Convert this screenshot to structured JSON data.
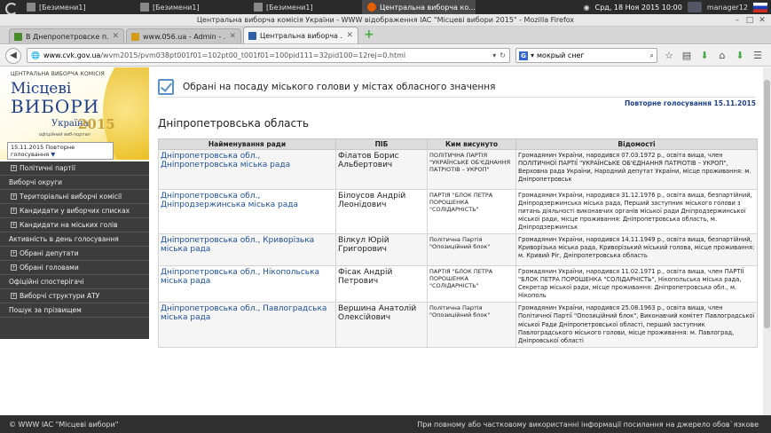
{
  "taskbar": {
    "items": [
      {
        "label": "[Безимени1]"
      },
      {
        "label": "[Безимени1]"
      },
      {
        "label": "[Безимени1]"
      },
      {
        "label": "Центральна виборча ко..."
      }
    ],
    "clock": "Срд, 18 Ноя 2015 10:00",
    "user": "manager12"
  },
  "window": {
    "title": "Центральна виборча комісія України - WWW відображення IAC \"Місцеві вибори 2015\" - Mozilla Firefox"
  },
  "tabs": [
    {
      "label": "В Днепропетровске п...",
      "color": "#4a8c2a"
    },
    {
      "label": "www.056.ua - Admin - ...",
      "color": "#d39b1a"
    },
    {
      "label": "Центральна виборча ...",
      "color": "#2f5fa8"
    }
  ],
  "navbar": {
    "url_host": "www.cvk.gov.ua",
    "url_path": "/wvm2015/pvm038pt001f01=102pt00_t001f01=100pid111=32pid100=12rej=0.html",
    "search_value": "мокрый снег",
    "search_engine": "G"
  },
  "logo": {
    "top": "ЦЕНТРАЛЬНА ВИБОРЧА КОМІСІЯ",
    "line1": "Місцеві",
    "line2": "ВИБОРИ",
    "country": "Україна",
    "year": "2015",
    "sub": "офіційний веб-портал"
  },
  "date_select": {
    "line1": "15.11.2015 Повторне",
    "line2": "голосування",
    "caret": "▼"
  },
  "menu": [
    {
      "label": "Політичні партії",
      "expandable": true
    },
    {
      "label": "Виборчі округи",
      "expandable": false
    },
    {
      "label": "Територіальні виборчі комісії",
      "expandable": true
    },
    {
      "label": "Кандидати у виборчих списках",
      "expandable": true
    },
    {
      "label": "Кандидати на міських голів",
      "expandable": true
    },
    {
      "label": "Активність в день голосування",
      "expandable": false
    },
    {
      "label": "Обрані депутати",
      "expandable": true
    },
    {
      "label": "Обрані головами",
      "expandable": true
    },
    {
      "label": "Офіційні спостерігачі",
      "expandable": false
    },
    {
      "label": "Виборчі структури АТУ",
      "expandable": true
    },
    {
      "label": "Пошук за прізвищем",
      "expandable": false
    }
  ],
  "main": {
    "page_title": "Обрані на посаду міського голови у містах обласного значення",
    "repeat_vote": "Повторне голосування 15.11.2015",
    "region_title": "Дніпропетровська область",
    "columns": [
      "Найменування ради",
      "ПІБ",
      "Ким висунуто",
      "Відомості"
    ],
    "rows": [
      {
        "council": "Дніпропетровська обл., Дніпропетровська міська рада",
        "name": "Філатов Борис Альбертович",
        "party": "ПОЛІТИЧНА ПАРТІЯ \"УКРАЇНСЬКЕ ОБ'ЄДНАННЯ ПАТРІОТІВ – УКРОП\"",
        "info": "Громадянин України, народився 07.03.1972 р., освіта вища, член ПОЛІТИЧНОЇ ПАРТІЇ \"УКРАЇНСЬКЕ ОБ'ЄДНАННЯ ПАТРІОТІВ – УКРОП\", Верховна рада України, Народний депутат України, місце проживання: м. Дніпропетровськ"
      },
      {
        "council": "Дніпропетровська обл., Дніпродзержинська міська рада",
        "name": "Білоусов Андрій Леонідович",
        "party": "ПАРТІЯ \"БЛОК ПЕТРА ПОРОШЕНКА \"СОЛІДАРНІСТЬ\"",
        "info": "Громадянин України, народився 31.12.1976 р., освіта вища, безпартійний, Дніпродзержинська міська рада, Перший заступник міського голови з питань діяльності виконавчих органів міської ради Дніпродзержинської міської ради, місце проживання: Дніпропетровська область, м. Дніпродзержинськ"
      },
      {
        "council": "Дніпропетровська обл., Криворізька міська рада",
        "name": "Вілкул Юрій Григорович",
        "party": "Політична Партія \"Опозиційний блок\"",
        "info": "Громадянин України, народився 14.11.1949 р., освіта вища, безпартійний, Криворізька міська рада, Криворізький міський голова, місце проживання: м. Кривий Ріг, Дніпропетровська область"
      },
      {
        "council": "Дніпропетровська обл., Нікопольська міська рада",
        "name": "Фісак Андрій Петрович",
        "party": "ПАРТІЯ \"БЛОК ПЕТРА ПОРОШЕНКА \"СОЛІДАРНІСТЬ\"",
        "info": "Громадянин України, народився 11.02.1971 р., освіта вища, член ПАРТІЇ \"БЛОК ПЕТРА ПОРОШЕНКА \"СОЛІДАРНІСТЬ\", Нікопольська міська рада, Секретар міської ради, місце проживання: Дніпропетровська обл., м. Нікополь"
      },
      {
        "council": "Дніпропетровська обл., Павлоградська міська рада",
        "name": "Вершина Анатолій Олексійович",
        "party": "Політична Партія \"Опозиційний блок\"",
        "info": "Громадянин України, народився 25.08.1963 р., освіта вища, член Політичної Партії \"Опозиційний блок\", Виконавчий комітет Павлоградської міської Ради Дніпропетровської області, перший заступник Павлоградського міського голови, місце проживання: м. Павлоград, Дніпровської області"
      }
    ]
  },
  "footer": {
    "left": "© WWW IAC \"Місцеві вибори\"",
    "right": "При повному або частковому використанні інформації посилання на джерело обов`язкове"
  }
}
